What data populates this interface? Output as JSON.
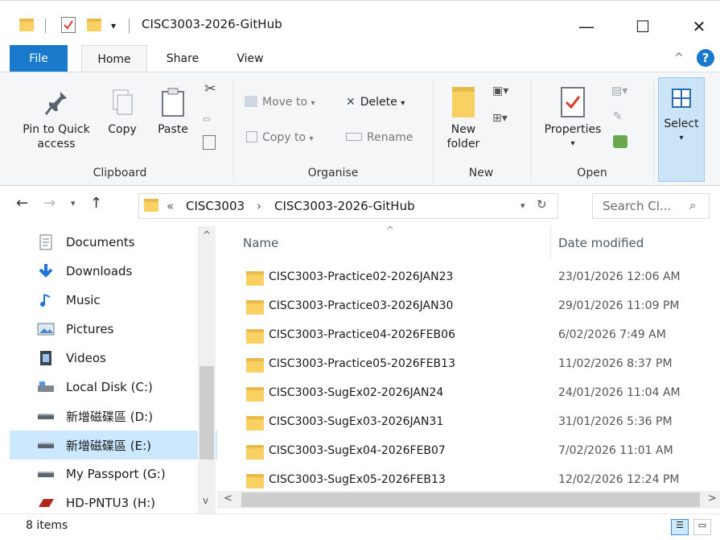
{
  "window": {
    "title": "CISC3003-2026-GitHub"
  },
  "window_controls": {
    "minimize": "—",
    "maximize": "☐",
    "close": "✕"
  },
  "ribbon_tabs": {
    "file": "File",
    "home": "Home",
    "share": "Share",
    "view": "View"
  },
  "ribbon": {
    "clipboard": {
      "label": "Clipboard",
      "pin_line1": "Pin to Quick",
      "pin_line2": "access",
      "copy": "Copy",
      "paste": "Paste"
    },
    "organise": {
      "label": "Organise",
      "move_to": "Move to",
      "copy_to": "Copy to",
      "delete": "Delete",
      "rename": "Rename"
    },
    "new": {
      "label": "New",
      "new_folder_line1": "New",
      "new_folder_line2": "folder"
    },
    "open": {
      "label": "Open",
      "properties": "Properties"
    },
    "select": {
      "label": "Select"
    }
  },
  "address": {
    "overflow": "«",
    "crumb1": "CISC3003",
    "sep": "›",
    "crumb2": "CISC3003-2026-GitHub"
  },
  "search": {
    "placeholder": "Search Cl..."
  },
  "nav": {
    "items": [
      {
        "label": "Documents",
        "icon": "documents-icon"
      },
      {
        "label": "Downloads",
        "icon": "downloads-icon"
      },
      {
        "label": "Music",
        "icon": "music-icon"
      },
      {
        "label": "Pictures",
        "icon": "pictures-icon"
      },
      {
        "label": "Videos",
        "icon": "videos-icon"
      },
      {
        "label": "Local Disk (C:)",
        "icon": "local-disk-icon"
      },
      {
        "label": "新增磁碟區 (D:)",
        "icon": "drive-icon"
      },
      {
        "label": "新增磁碟區 (E:)",
        "icon": "drive-icon"
      },
      {
        "label": "My Passport (G:)",
        "icon": "drive-icon"
      },
      {
        "label": "HD-PNTU3 (H:)",
        "icon": "external-drive-icon"
      }
    ]
  },
  "columns": {
    "name": "Name",
    "date": "Date modified"
  },
  "files": [
    {
      "name": "CISC3003-Practice02-2026JAN23",
      "date": "23/01/2026 12:06 AM"
    },
    {
      "name": "CISC3003-Practice03-2026JAN30",
      "date": "29/01/2026 11:09 PM"
    },
    {
      "name": "CISC3003-Practice04-2026FEB06",
      "date": "6/02/2026 7:49 AM"
    },
    {
      "name": "CISC3003-Practice05-2026FEB13",
      "date": "11/02/2026 8:37 PM"
    },
    {
      "name": "CISC3003-SugEx02-2026JAN24",
      "date": "24/01/2026 11:04 AM"
    },
    {
      "name": "CISC3003-SugEx03-2026JAN31",
      "date": "31/01/2026 5:36 PM"
    },
    {
      "name": "CISC3003-SugEx04-2026FEB07",
      "date": "7/02/2026 11:01 AM"
    },
    {
      "name": "CISC3003-SugEx05-2026FEB13",
      "date": "12/02/2026 12:24 PM"
    }
  ],
  "status": {
    "count": "8 items"
  },
  "colors": {
    "accent": "#1979ca",
    "folder": "#f8d162",
    "selected": "#cce8ff"
  }
}
